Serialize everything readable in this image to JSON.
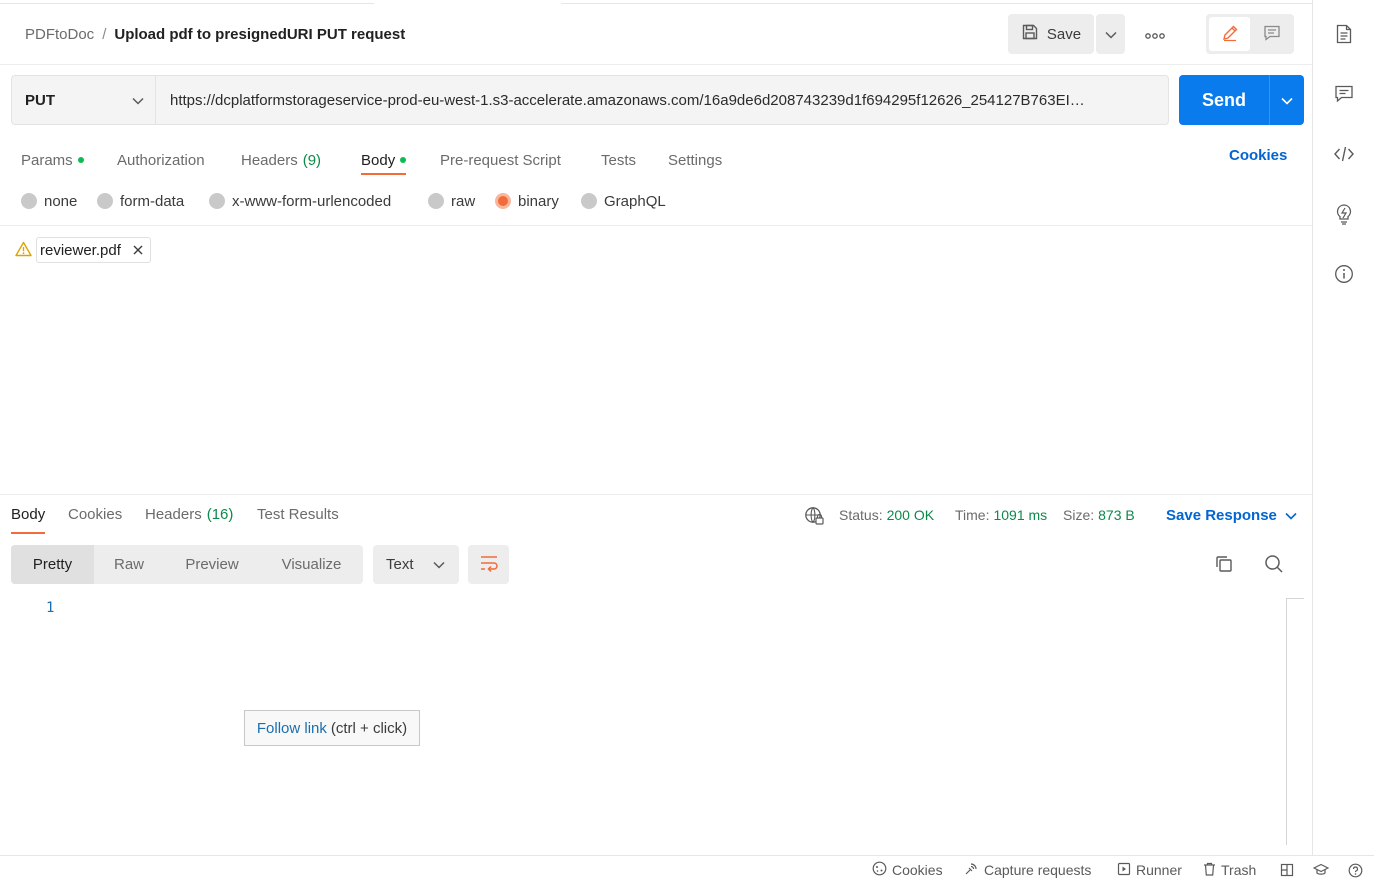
{
  "breadcrumb": {
    "collection": "PDFtoDoc",
    "separator": "/",
    "request_name": "Upload pdf to presignedURI PUT request"
  },
  "toolbar": {
    "save_label": "Save",
    "more_icon": "ellipsis-icon",
    "edit_icon": "pencil-icon",
    "comment_icon": "comment-icon"
  },
  "request": {
    "method": "PUT",
    "url": "https://dcplatformstorageservice-prod-eu-west-1.s3-accelerate.amazonaws.com/16a9de6d208743239d1f694295f12626_254127B763EI…",
    "send_label": "Send"
  },
  "request_tabs": [
    {
      "label": "Params",
      "dot": true
    },
    {
      "label": "Authorization"
    },
    {
      "label": "Headers",
      "count": "(9)"
    },
    {
      "label": "Body",
      "dot": true,
      "active": true
    },
    {
      "label": "Pre-request Script"
    },
    {
      "label": "Tests"
    },
    {
      "label": "Settings"
    }
  ],
  "cookies_link": "Cookies",
  "body_types": [
    {
      "label": "none"
    },
    {
      "label": "form-data"
    },
    {
      "label": "x-www-form-urlencoded"
    },
    {
      "label": "raw"
    },
    {
      "label": "binary",
      "selected": true
    },
    {
      "label": "GraphQL"
    }
  ],
  "binary_file": {
    "filename": "reviewer.pdf",
    "warning_icon": "warning-icon"
  },
  "response": {
    "tabs": [
      {
        "label": "Body",
        "active": true
      },
      {
        "label": "Cookies"
      },
      {
        "label": "Headers",
        "count": "(16)"
      },
      {
        "label": "Test Results"
      }
    ],
    "status_label": "Status:",
    "status_value": "200 OK",
    "time_label": "Time:",
    "time_value": "1091 ms",
    "size_label": "Size:",
    "size_value": "873 B",
    "save_response_label": "Save Response",
    "view_modes": [
      "Pretty",
      "Raw",
      "Preview",
      "Visualize"
    ],
    "format": "Text",
    "line_number": "1"
  },
  "tooltip": {
    "link_text": "Follow link",
    "hint": "(ctrl + click)"
  },
  "right_sidebar_icons": [
    "documentation-icon",
    "comments-icon",
    "code-icon",
    "lightbulb-icon",
    "info-icon"
  ],
  "footer": {
    "cookies": "Cookies",
    "capture": "Capture requests",
    "runner": "Runner",
    "trash": "Trash"
  },
  "colors": {
    "accent": "#f26b3a",
    "send_blue": "#097bed",
    "link_blue": "#0265d2",
    "success_green": "#0c8a4a"
  }
}
